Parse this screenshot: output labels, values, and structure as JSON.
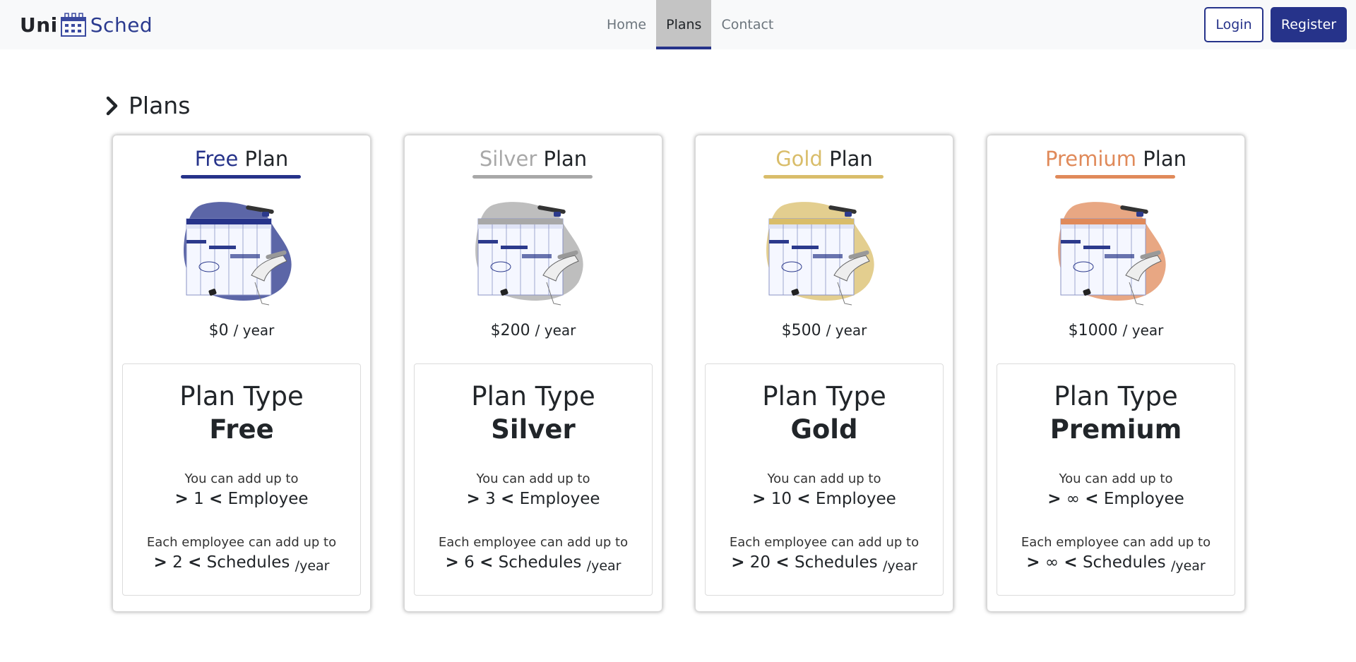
{
  "brand": {
    "part1": "Uni",
    "part2": "Sched"
  },
  "nav": {
    "home": "Home",
    "plans": "Plans",
    "contact": "Contact"
  },
  "auth": {
    "login": "Login",
    "register": "Register"
  },
  "section": {
    "title": "Plans"
  },
  "colors": {
    "free": "#26338a",
    "silver": "#a8a8a8",
    "gold": "#d9bd6a",
    "premium": "#e08a5a"
  },
  "plans": [
    {
      "name": "Free",
      "plan_word": "Plan",
      "price": "$0",
      "per": "/ year",
      "type_label": "Plan Type",
      "type": "Free",
      "emp_intro": "You can add up to",
      "emp_open": ">",
      "emp_count": "1",
      "emp_close": "<",
      "emp_unit": "Employee",
      "sched_intro": "Each employee can add up to",
      "sched_open": ">",
      "sched_count": "2",
      "sched_close": "<",
      "sched_unit": "Schedules",
      "sched_per": "/year"
    },
    {
      "name": "Silver",
      "plan_word": "Plan",
      "price": "$200",
      "per": "/ year",
      "type_label": "Plan Type",
      "type": "Silver",
      "emp_intro": "You can add up to",
      "emp_open": ">",
      "emp_count": "3",
      "emp_close": "<",
      "emp_unit": "Employee",
      "sched_intro": "Each employee can add up to",
      "sched_open": ">",
      "sched_count": "6",
      "sched_close": "<",
      "sched_unit": "Schedules",
      "sched_per": "/year"
    },
    {
      "name": "Gold",
      "plan_word": "Plan",
      "price": "$500",
      "per": "/ year",
      "type_label": "Plan Type",
      "type": "Gold",
      "emp_intro": "You can add up to",
      "emp_open": ">",
      "emp_count": "10",
      "emp_close": "<",
      "emp_unit": "Employee",
      "sched_intro": "Each employee can add up to",
      "sched_open": ">",
      "sched_count": "20",
      "sched_close": "<",
      "sched_unit": "Schedules",
      "sched_per": "/year"
    },
    {
      "name": "Premium",
      "plan_word": "Plan",
      "price": "$1000",
      "per": "/ year",
      "type_label": "Plan Type",
      "type": "Premium",
      "emp_intro": "You can add up to",
      "emp_open": ">",
      "emp_count": "∞",
      "emp_close": "<",
      "emp_unit": "Employee",
      "sched_intro": "Each employee can add up to",
      "sched_open": ">",
      "sched_count": "∞",
      "sched_close": "<",
      "sched_unit": "Schedules",
      "sched_per": "/year"
    }
  ]
}
